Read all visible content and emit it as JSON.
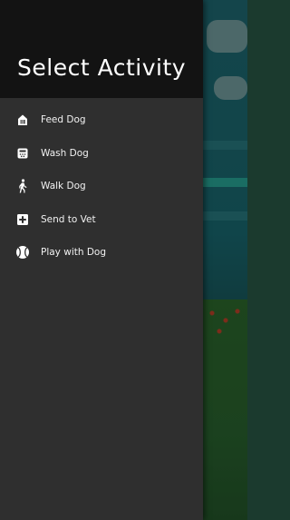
{
  "drawer": {
    "title": "Select Activity",
    "items": [
      {
        "label": "Feed Dog",
        "icon": "food-icon"
      },
      {
        "label": "Wash Dog",
        "icon": "shower-icon"
      },
      {
        "label": "Walk Dog",
        "icon": "walk-icon"
      },
      {
        "label": "Send to Vet",
        "icon": "medical-cross-icon"
      },
      {
        "label": "Play with Dog",
        "icon": "ball-icon"
      }
    ]
  },
  "colors": {
    "drawer_background": "#2f2f2f",
    "header_background": "#131313",
    "text": "#ffffff",
    "scene_sky": "#1f6b73",
    "scene_grass": "#2e6b2f"
  }
}
